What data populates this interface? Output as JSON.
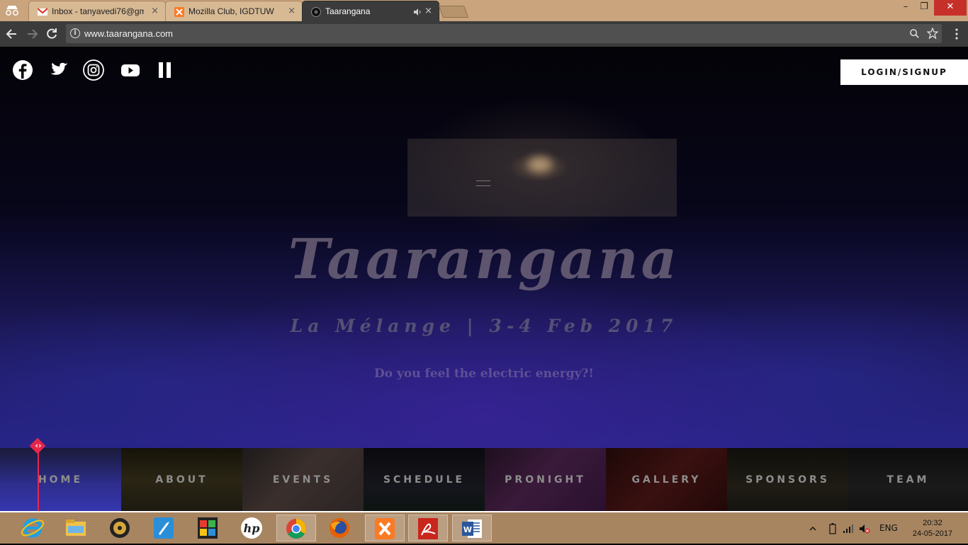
{
  "browser": {
    "tabs": [
      {
        "title": "Inbox - tanyavedi76@gm",
        "close": "×"
      },
      {
        "title": "Mozilla Club, IGDTUW",
        "close": "×"
      },
      {
        "title": "Taarangana",
        "close": "×"
      }
    ],
    "url": "www.taarangana.com",
    "window_controls": {
      "minimize": "–",
      "restore": "❐",
      "close": "✕"
    }
  },
  "page": {
    "login_label": "LOGIN/SIGNUP",
    "hero": {
      "title": "Taarangana",
      "subtitle": "La Mélange | 3-4 Feb 2017",
      "tagline": "Do you feel the electric energy?!"
    },
    "sections": [
      "HOME",
      "ABOUT",
      "EVENTS",
      "SCHEDULE",
      "PRONIGHT",
      "GALLERY",
      "SPONSORS",
      "TEAM"
    ],
    "marker_label": "‹›",
    "accent_color": "#e8264a"
  },
  "taskbar": {
    "apps": [
      "internet-explorer-icon",
      "file-explorer-icon",
      "media-player-icon",
      "rocket-app-icon",
      "puzzle-app-icon",
      "hp-icon",
      "chrome-icon",
      "firefox-icon",
      "xampp-icon",
      "acrobat-icon",
      "word-icon"
    ],
    "language": "ENG",
    "time": "20:32",
    "date": "24-05-2017"
  }
}
